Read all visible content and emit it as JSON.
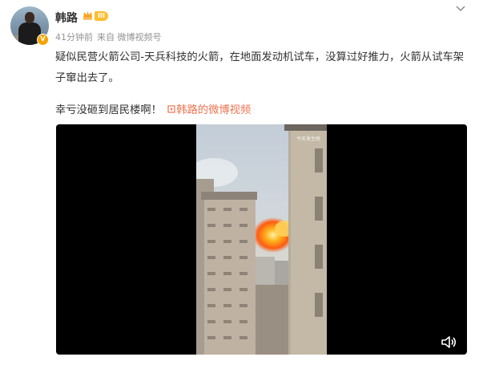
{
  "user": {
    "name": "韩路",
    "level": "III",
    "verified_mark": "V"
  },
  "meta": {
    "time": "41分钟前",
    "source": "来自 微博视频号"
  },
  "content": {
    "line1": "疑似民营火箭公司-天兵科技的火箭，在地面发动机试车，没算过好推力，火箭从试车架子窜出去了。",
    "line2": "幸亏没砸到居民楼啊！",
    "video_link": "韩路的微博视频"
  },
  "video": {
    "watermark": "今天发生啥"
  },
  "colors": {
    "link": "#eb7350",
    "badge": "#ffbe2e",
    "text": "#333333",
    "meta": "#939393"
  },
  "icons": [
    "verified-icon",
    "crown-icon",
    "chevron-down-icon",
    "video-link-icon",
    "sound-icon"
  ]
}
